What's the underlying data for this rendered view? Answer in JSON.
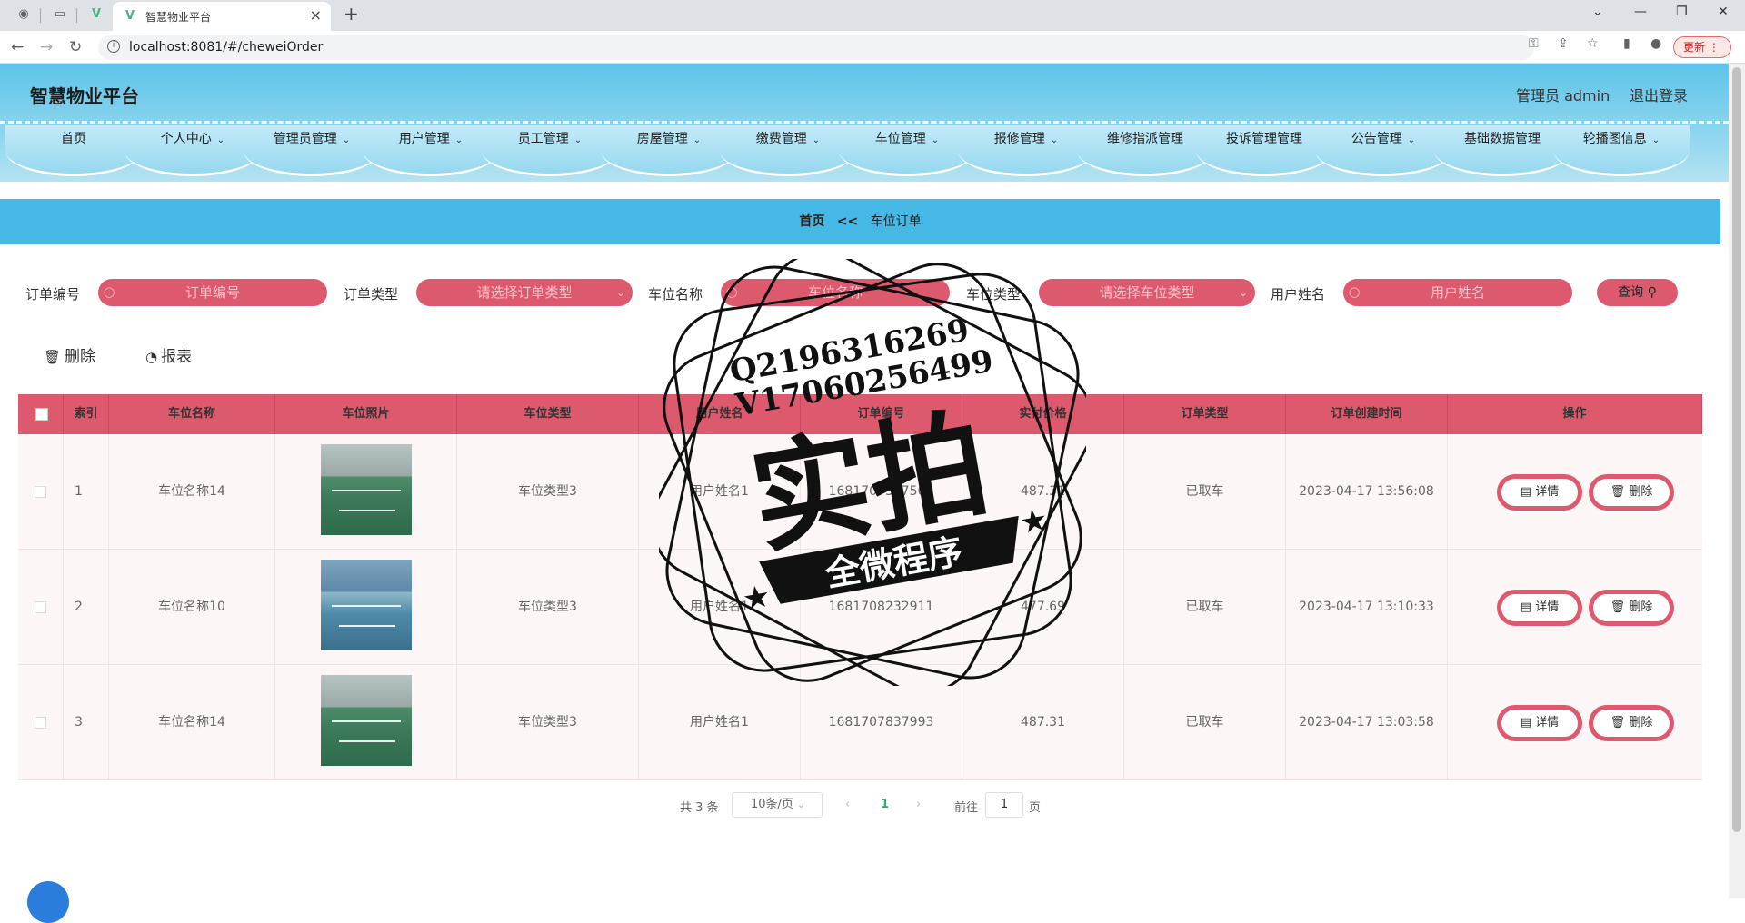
{
  "browser": {
    "tab_title": "智慧物业平台",
    "url": "localhost:8081/#/cheweiOrder",
    "update_label": "更新"
  },
  "header": {
    "app_title": "智慧物业平台",
    "admin": "管理员 admin",
    "logout": "退出登录"
  },
  "menu": [
    {
      "label": "首页",
      "has_dropdown": false
    },
    {
      "label": "个人中心",
      "has_dropdown": true
    },
    {
      "label": "管理员管理",
      "has_dropdown": true
    },
    {
      "label": "用户管理",
      "has_dropdown": true
    },
    {
      "label": "员工管理",
      "has_dropdown": true
    },
    {
      "label": "房屋管理",
      "has_dropdown": true
    },
    {
      "label": "缴费管理",
      "has_dropdown": true
    },
    {
      "label": "车位管理",
      "has_dropdown": true
    },
    {
      "label": "报修管理",
      "has_dropdown": true
    },
    {
      "label": "维修指派管理",
      "has_dropdown": false
    },
    {
      "label": "投诉管理管理",
      "has_dropdown": false
    },
    {
      "label": "公告管理",
      "has_dropdown": true
    },
    {
      "label": "基础数据管理",
      "has_dropdown": false
    },
    {
      "label": "轮播图信息",
      "has_dropdown": true
    }
  ],
  "breadcrumb": {
    "home": "首页",
    "sep": "<<",
    "current": "车位订单"
  },
  "search": {
    "order_no_label": "订单编号",
    "order_no_placeholder": "订单编号",
    "order_type_label": "订单类型",
    "order_type_placeholder": "请选择订单类型",
    "spot_name_label": "车位名称",
    "spot_name_placeholder": "车位名称",
    "spot_type_label": "车位类型",
    "spot_type_placeholder": "请选择车位类型",
    "user_name_label": "用户姓名",
    "user_name_placeholder": "用户姓名",
    "query_label": "查询"
  },
  "actions": {
    "delete": "删除",
    "report": "报表"
  },
  "table": {
    "headers": [
      "索引",
      "车位名称",
      "车位照片",
      "车位类型",
      "用户姓名",
      "订单编号",
      "实付价格",
      "订单类型",
      "订单创建时间",
      "操作"
    ],
    "rows": [
      {
        "index": "1",
        "name": "车位名称14",
        "type": "车位类型3",
        "user": "用户姓名1",
        "order_no": "1681707367500",
        "price": "487.31",
        "order_type": "已取车",
        "created": "2023-04-17 13:56:08",
        "photo": "green"
      },
      {
        "index": "2",
        "name": "车位名称10",
        "type": "车位类型3",
        "user": "用户姓名1",
        "order_no": "1681708232911",
        "price": "477.69",
        "order_type": "已取车",
        "created": "2023-04-17 13:10:33",
        "photo": "blue"
      },
      {
        "index": "3",
        "name": "车位名称14",
        "type": "车位类型3",
        "user": "用户姓名1",
        "order_no": "1681707837993",
        "price": "487.31",
        "order_type": "已取车",
        "created": "2023-04-17 13:03:58",
        "photo": "green"
      }
    ],
    "detail_label": "详情",
    "delete_label": "删除"
  },
  "pagination": {
    "total": "共 3 条",
    "page_size": "10条/页",
    "current": "1",
    "goto_prefix": "前往",
    "goto_value": "1",
    "goto_suffix": "页"
  },
  "watermark": {
    "line1": "Q2196316269",
    "line2": "V17060256499",
    "big": "实拍",
    "ribbon": "全微程序"
  },
  "colors": {
    "accent": "#dd5a6e",
    "header": "#5ec4e8",
    "crumb": "#45b8e6"
  }
}
